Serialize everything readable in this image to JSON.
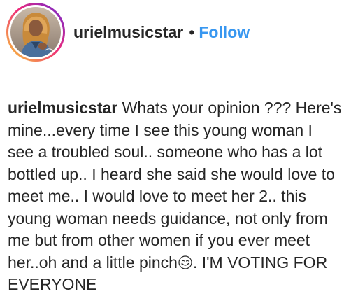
{
  "post_header": {
    "username": "urielmusicstar",
    "separator": "•",
    "follow_label": "Follow"
  },
  "caption": {
    "username": "urielmusicstar",
    "text_before_emoji": " Whats your opinion ??? Here's mine...every time I see this young woman I see a troubled soul.. someone who has a lot bottled up.. I heard she said she would love to meet me.. I would love to meet her 2.. this young woman needs guidance, not only from me but from other women if you ever meet her..oh and a little pinch",
    "emoji": "smiling-face-emoji",
    "text_after_emoji": ". I'M VOTING FOR EVERYONE"
  },
  "colors": {
    "follow_blue": "#3897f0",
    "text": "#262626",
    "story_ring_start": "#f9ce34",
    "story_ring_end": "#6228d7"
  }
}
